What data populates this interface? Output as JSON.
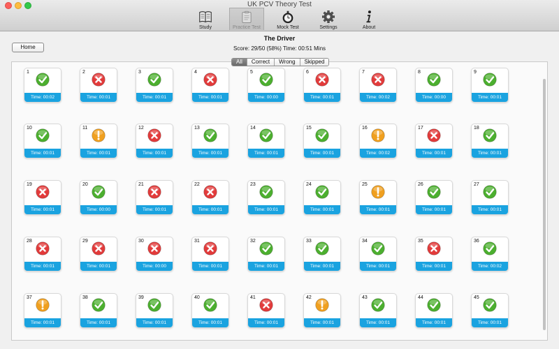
{
  "window": {
    "title": "UK PCV Theory Test"
  },
  "toolbar": [
    {
      "label": "Study",
      "icon": "book-icon"
    },
    {
      "label": "Practice Test",
      "icon": "clipboard-icon"
    },
    {
      "label": "Mock Test",
      "icon": "stopwatch-icon"
    },
    {
      "label": "Settings",
      "icon": "gear-icon"
    },
    {
      "label": "About",
      "icon": "info-icon"
    }
  ],
  "home_label": "Home",
  "heading": "The Driver",
  "score_text": "Score: 29/50 (58%) Time: 00:51 Mins",
  "filters": [
    "All",
    "Correct",
    "Wrong",
    "Skipped"
  ],
  "selected_filter": "All",
  "colors": {
    "correct": "#4caf2f",
    "wrong": "#e23b3b",
    "skipped": "#f0a020",
    "time_bar": "#1aa3e0"
  },
  "questions": [
    {
      "number": "1",
      "status": "correct",
      "time": "Time: 00:02"
    },
    {
      "number": "2",
      "status": "wrong",
      "time": "Time: 00:01"
    },
    {
      "number": "3",
      "status": "correct",
      "time": "Time: 00:01"
    },
    {
      "number": "4",
      "status": "wrong",
      "time": "Time: 00:01"
    },
    {
      "number": "5",
      "status": "correct",
      "time": "Time: 00:00"
    },
    {
      "number": "6",
      "status": "wrong",
      "time": "Time: 00:01"
    },
    {
      "number": "7",
      "status": "wrong",
      "time": "Time: 00:02"
    },
    {
      "number": "8",
      "status": "correct",
      "time": "Time: 00:00"
    },
    {
      "number": "9",
      "status": "correct",
      "time": "Time: 00:01"
    },
    {
      "number": "10",
      "status": "correct",
      "time": "Time: 00:01"
    },
    {
      "number": "11",
      "status": "skipped",
      "time": "Time: 00:01"
    },
    {
      "number": "12",
      "status": "wrong",
      "time": "Time: 00:01"
    },
    {
      "number": "13",
      "status": "correct",
      "time": "Time: 00:01"
    },
    {
      "number": "14",
      "status": "correct",
      "time": "Time: 00:01"
    },
    {
      "number": "15",
      "status": "correct",
      "time": "Time: 00:01"
    },
    {
      "number": "16",
      "status": "skipped",
      "time": "Time: 00:02"
    },
    {
      "number": "17",
      "status": "wrong",
      "time": "Time: 00:01"
    },
    {
      "number": "18",
      "status": "correct",
      "time": "Time: 00:01"
    },
    {
      "number": "19",
      "status": "wrong",
      "time": "Time: 00:01"
    },
    {
      "number": "20",
      "status": "correct",
      "time": "Time: 00:00"
    },
    {
      "number": "21",
      "status": "wrong",
      "time": "Time: 00:01"
    },
    {
      "number": "22",
      "status": "wrong",
      "time": "Time: 00:01"
    },
    {
      "number": "23",
      "status": "correct",
      "time": "Time: 00:01"
    },
    {
      "number": "24",
      "status": "correct",
      "time": "Time: 00:01"
    },
    {
      "number": "25",
      "status": "skipped",
      "time": "Time: 00:01"
    },
    {
      "number": "26",
      "status": "correct",
      "time": "Time: 00:01"
    },
    {
      "number": "27",
      "status": "correct",
      "time": "Time: 00:01"
    },
    {
      "number": "28",
      "status": "wrong",
      "time": "Time: 00:01"
    },
    {
      "number": "29",
      "status": "wrong",
      "time": "Time: 00:01"
    },
    {
      "number": "30",
      "status": "wrong",
      "time": "Time: 00:00"
    },
    {
      "number": "31",
      "status": "wrong",
      "time": "Time: 00:01"
    },
    {
      "number": "32",
      "status": "correct",
      "time": "Time: 00:01"
    },
    {
      "number": "33",
      "status": "correct",
      "time": "Time: 00:01"
    },
    {
      "number": "34",
      "status": "correct",
      "time": "Time: 00:01"
    },
    {
      "number": "35",
      "status": "wrong",
      "time": "Time: 00:01"
    },
    {
      "number": "36",
      "status": "correct",
      "time": "Time: 00:02"
    },
    {
      "number": "37",
      "status": "skipped",
      "time": "Time: 00:01"
    },
    {
      "number": "38",
      "status": "correct",
      "time": "Time: 00:01"
    },
    {
      "number": "39",
      "status": "correct",
      "time": "Time: 00:01"
    },
    {
      "number": "40",
      "status": "correct",
      "time": "Time: 00:01"
    },
    {
      "number": "41",
      "status": "wrong",
      "time": "Time: 00:01"
    },
    {
      "number": "42",
      "status": "skipped",
      "time": "Time: 00:01"
    },
    {
      "number": "43",
      "status": "correct",
      "time": "Time: 00:01"
    },
    {
      "number": "44",
      "status": "correct",
      "time": "Time: 00:01"
    },
    {
      "number": "45",
      "status": "correct",
      "time": "Time: 00:01"
    }
  ]
}
